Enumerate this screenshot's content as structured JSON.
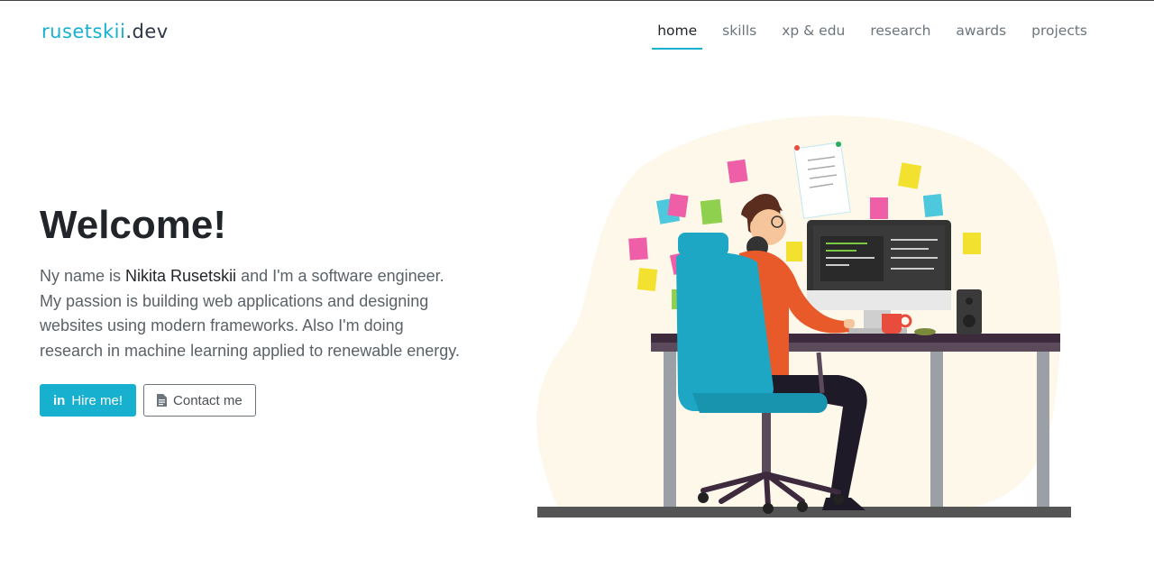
{
  "brand": {
    "part1": "rusetskii",
    "part2": ".dev"
  },
  "nav": {
    "items": [
      {
        "label": "home",
        "active": true
      },
      {
        "label": "skills",
        "active": false
      },
      {
        "label": "xp & edu",
        "active": false
      },
      {
        "label": "research",
        "active": false
      },
      {
        "label": "awards",
        "active": false
      },
      {
        "label": "projects",
        "active": false
      }
    ]
  },
  "hero": {
    "title": "Welcome!",
    "intro_prefix": "Ny name is ",
    "name": "Nikita Rusetskii",
    "intro_suffix": " and I'm a software engineer. My passion is building web applications and designing websites using modern frameworks. Also I'm doing research in machine learning applied to renewable energy.",
    "buttons": {
      "hire_label": "Hire me!",
      "hire_icon": "linkedin-icon",
      "contact_label": "Contact me",
      "contact_icon": "document-icon"
    }
  },
  "colors": {
    "accent": "#17b0cf",
    "text_dark": "#212529",
    "text_muted": "#6c757d"
  }
}
